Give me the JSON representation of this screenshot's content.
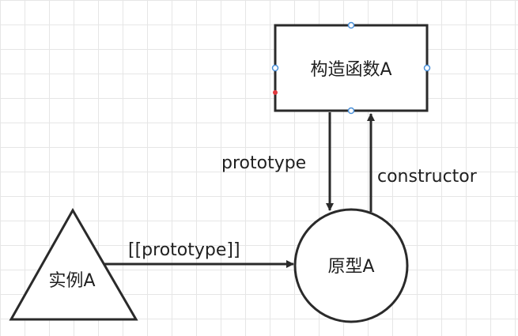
{
  "nodes": {
    "constructor_box": {
      "label": "构造函数A"
    },
    "prototype_circle": {
      "label": "原型A"
    },
    "instance_triangle": {
      "label": "实例A"
    }
  },
  "edges": {
    "prototype": {
      "label": "prototype"
    },
    "constructor": {
      "label": "constructor"
    },
    "proto_link": {
      "label": "[[prototype]]"
    }
  },
  "colors": {
    "stroke": "#2a2a2a",
    "handle": "#4a90d9",
    "handle_active": "#e0393e",
    "grid": "#e6e6e6"
  }
}
